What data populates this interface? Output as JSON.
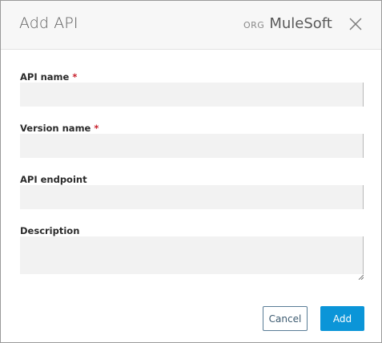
{
  "dialog": {
    "title": "Add API",
    "org_label": "ORG",
    "org_name": "MuleSoft",
    "close_icon": "close-icon"
  },
  "fields": {
    "api_name": {
      "label": "API name",
      "required_mark": "*",
      "value": ""
    },
    "version_name": {
      "label": "Version name",
      "required_mark": "*",
      "value": ""
    },
    "api_endpoint": {
      "label": "API endpoint",
      "value": ""
    },
    "description": {
      "label": "Description",
      "value": ""
    }
  },
  "buttons": {
    "cancel_label": "Cancel",
    "add_label": "Add"
  },
  "colors": {
    "primary": "#0b95d8",
    "required": "#c8212d",
    "field_bg": "#f2f2f2"
  }
}
